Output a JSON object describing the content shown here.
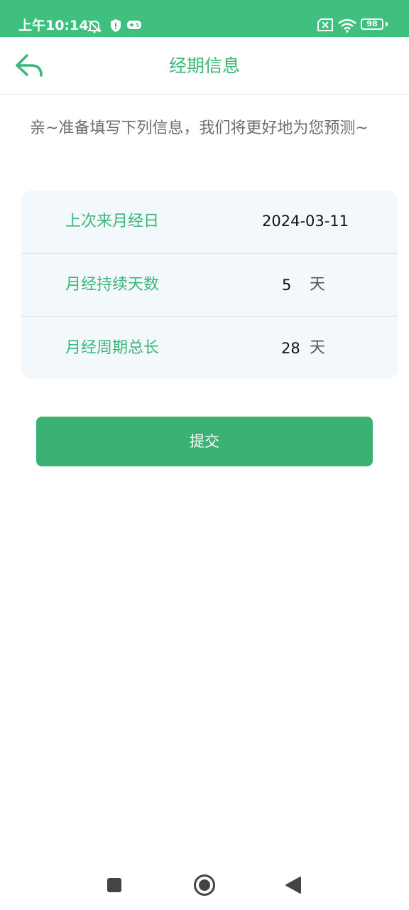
{
  "status_bar": {
    "time": "上午10:14",
    "battery": "98",
    "icons": [
      "alarm-off-icon",
      "shield-icon",
      "gamepad-icon",
      "sim-off-icon",
      "wifi-icon",
      "battery-icon"
    ],
    "color": "#40c07f"
  },
  "header": {
    "title": "经期信息",
    "back_icon": "back-arrow-icon"
  },
  "intro_text": "亲~准备填写下列信息，我们将更好地为您预测~",
  "form": {
    "rows": [
      {
        "label": "上次来月经日",
        "value": "2024-03-11",
        "unit": ""
      },
      {
        "label": "月经持续天数",
        "value": "5",
        "unit": "天"
      },
      {
        "label": "月经周期总长",
        "value": "28",
        "unit": "天"
      }
    ]
  },
  "submit_label": "提交",
  "nav_bar": {
    "icons": [
      "square-recents-icon",
      "circle-home-icon",
      "triangle-back-icon"
    ]
  },
  "colors": {
    "accent": "#3bb679",
    "button": "#3bb273",
    "card_bg": "#f3f8fc"
  }
}
